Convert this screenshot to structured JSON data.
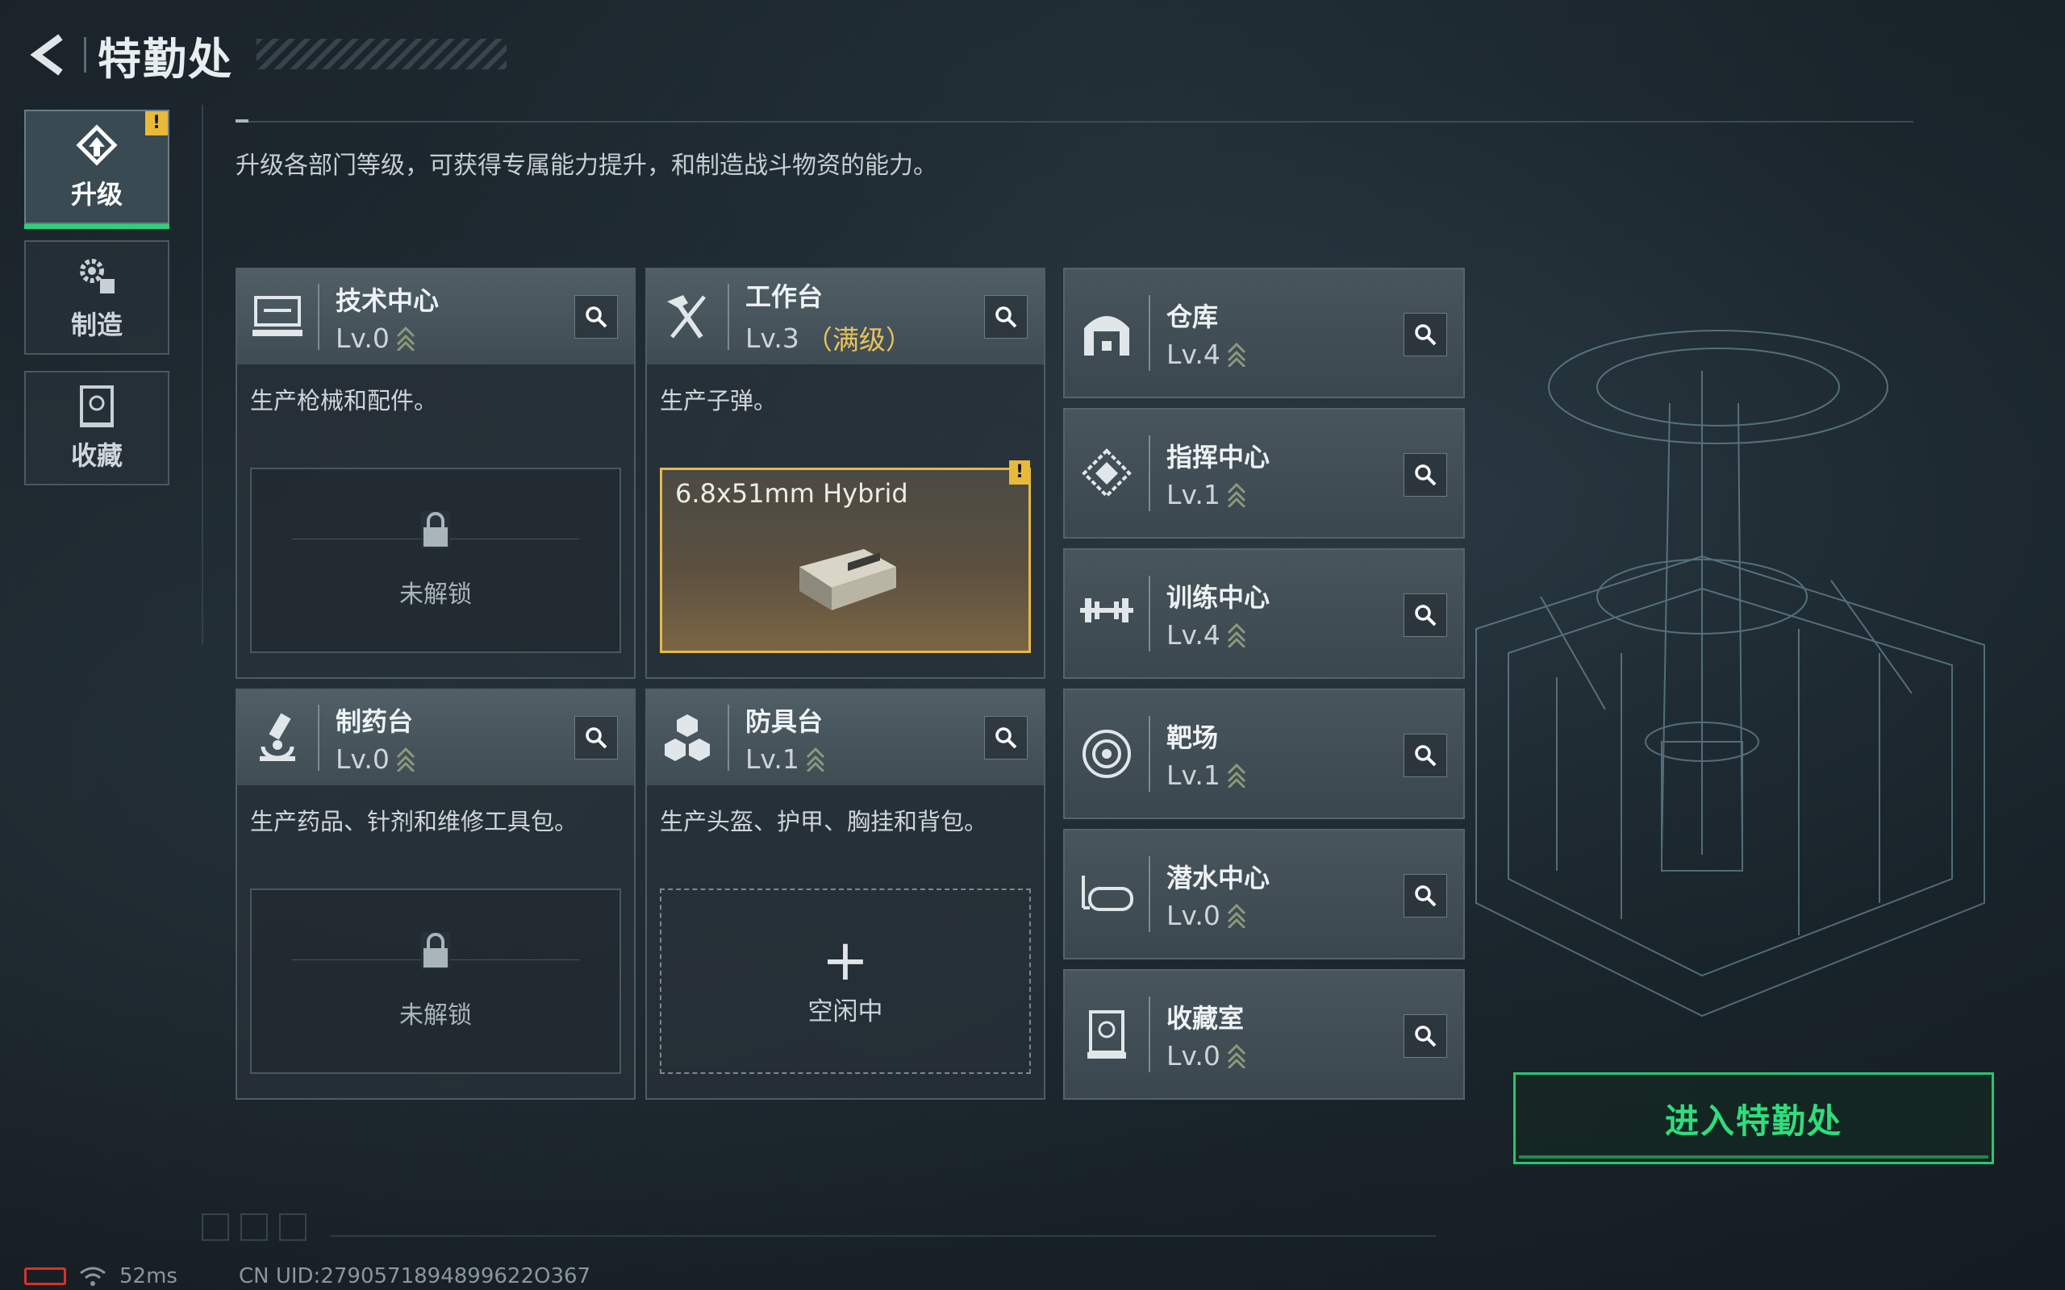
{
  "header": {
    "title": "特勤处"
  },
  "tabs": [
    {
      "label": "升级",
      "icon": "upgrade-icon",
      "active": true,
      "alert": "!"
    },
    {
      "label": "制造",
      "icon": "gears-icon",
      "active": false
    },
    {
      "label": "收藏",
      "icon": "trophy-case-icon",
      "active": false
    }
  ],
  "description": "升级各部门等级，可获得专属能力提升，和制造战斗物资的能力。",
  "workshops": [
    {
      "name": "技术中心",
      "level": "Lv.0",
      "desc": "生产枪械和配件。",
      "slot": "未解锁"
    },
    {
      "name": "工作台",
      "level": "Lv.3",
      "max_label": "（满级）",
      "desc": "生产子弹。",
      "item": "6.8x51mm Hybrid",
      "alert": "!"
    },
    {
      "name": "制药台",
      "level": "Lv.0",
      "desc": "生产药品、针剂和维修工具包。",
      "slot": "未解锁"
    },
    {
      "name": "防具台",
      "level": "Lv.1",
      "desc": "生产头盔、护甲、胸挂和背包。",
      "slot_plus": "+",
      "slot": "空闲中"
    }
  ],
  "facilities": [
    {
      "name": "仓库",
      "level": "Lv.4",
      "icon": "warehouse-icon"
    },
    {
      "name": "指挥中心",
      "level": "Lv.1",
      "icon": "command-center-icon"
    },
    {
      "name": "训练中心",
      "level": "Lv.4",
      "icon": "dumbbell-icon"
    },
    {
      "name": "靶场",
      "level": "Lv.1",
      "icon": "target-icon"
    },
    {
      "name": "潜水中心",
      "level": "Lv.0",
      "icon": "diving-mask-icon"
    },
    {
      "name": "收藏室",
      "level": "Lv.0",
      "icon": "trophy-case-icon"
    }
  ],
  "enter_button": "进入特勤处",
  "status": {
    "ping": "52ms",
    "uid": "CN UID:2790571894899622O367"
  },
  "colors": {
    "accent": "#2ed17a",
    "alert": "#e9b93a",
    "max_level": "#e8c35a",
    "battery": "#d8322a"
  }
}
